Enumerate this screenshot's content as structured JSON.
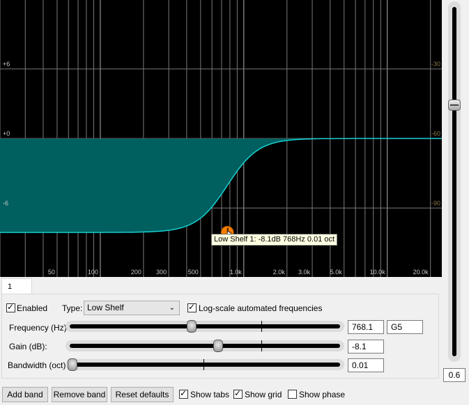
{
  "graph": {
    "left_ticks": [
      "+6",
      "+0",
      "-6"
    ],
    "right_ticks": [
      "-30",
      "-60",
      "-90"
    ],
    "freq_labels": [
      "50",
      "100",
      "200",
      "300",
      "500",
      "1.0k",
      "2.0k",
      "3.0k",
      "5.0k",
      "10.0k",
      "20.0k"
    ],
    "fill_color": "#006060",
    "curve_color": "#19d0d0",
    "handle_color": "#ff7f00"
  },
  "tooltip": "Low Shelf 1: -8.1dB 768Hz 0.01 oct",
  "vertical_slider": {
    "value_label": "0.6",
    "level": 0.72
  },
  "tab_label": "1",
  "band": {
    "enabled_label": "Enabled",
    "enabled": true,
    "type_label": "Type:",
    "type_value": "Low Shelf",
    "logscale_label": "Log-scale automated frequencies",
    "logscale": true,
    "frequency_label": "Frequency (Hz):",
    "frequency_value": "768.1",
    "note_value": "G5",
    "frequency_level": 0.45,
    "gain_label": "Gain (dB):",
    "gain_value": "-8.1",
    "gain_level": 0.55,
    "bandwidth_label": "Bandwidth (oct):",
    "bandwidth_value": "0.01",
    "bandwidth_level": 0.0
  },
  "buttons": {
    "add_band": "Add band",
    "remove_band": "Remove band",
    "reset_defaults": "Reset defaults"
  },
  "toggles": {
    "show_tabs": "Show tabs",
    "show_tabs_on": true,
    "show_grid": "Show grid",
    "show_grid_on": true,
    "show_phase": "Show phase",
    "show_phase_on": false
  }
}
